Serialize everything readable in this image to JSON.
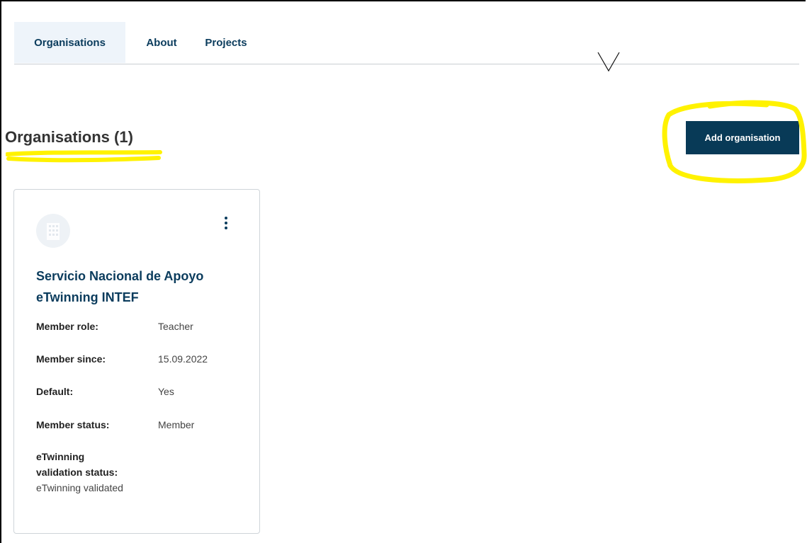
{
  "tabs": [
    {
      "label": "Organisations",
      "active": true
    },
    {
      "label": "About",
      "active": false
    },
    {
      "label": "Projects",
      "active": false
    }
  ],
  "page": {
    "title": "Organisations (1)",
    "add_button_label": "Add organisation"
  },
  "colors": {
    "accent": "#083a57",
    "link": "#0b3c5d",
    "highlight": "#fff200"
  },
  "card": {
    "name": "Servicio Nacional de Apoyo eTwinning INTEF",
    "rows": [
      {
        "label": "Member role:",
        "value": "Teacher"
      },
      {
        "label": "Member since:",
        "value": "15.09.2022"
      },
      {
        "label": "Default:",
        "value": "Yes"
      },
      {
        "label": "Member status:",
        "value": "Member"
      }
    ],
    "validation": {
      "label_line1": "eTwinning",
      "label_line2": "validation status:",
      "value": "eTwinning validated"
    },
    "avatar_icon": "building-icon",
    "menu_icon": "kebab-menu-icon"
  }
}
